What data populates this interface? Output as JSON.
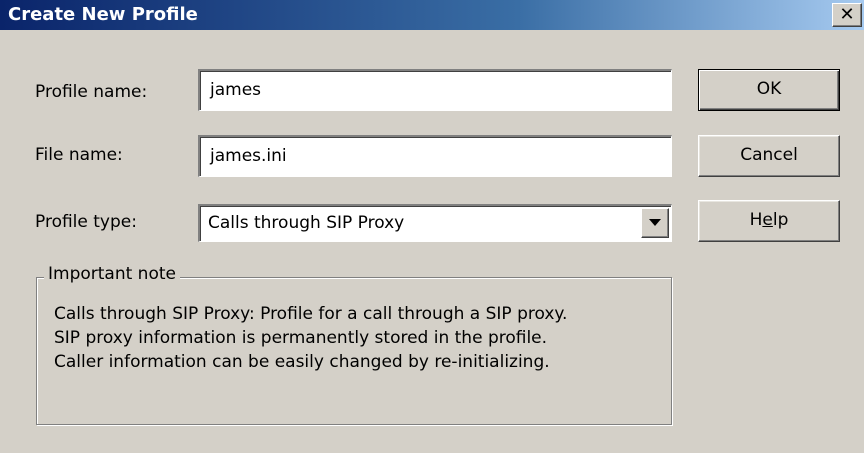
{
  "window": {
    "title": "Create New Profile",
    "close_glyph": "✕",
    "close_icon": "close-icon"
  },
  "form": {
    "profile_name_label": "Profile name:",
    "profile_name_value": "james",
    "file_name_label": "File name:",
    "file_name_value": "james.ini",
    "profile_type_label": "Profile type:",
    "profile_type_value": "Calls through SIP Proxy",
    "dropdown_icon": "chevron-down-icon"
  },
  "buttons": {
    "ok": "OK",
    "cancel": "Cancel",
    "help_pre": "H",
    "help_mnemonic": "e",
    "help_post": "lp"
  },
  "note": {
    "title": "Important note",
    "lines": [
      "Calls through SIP Proxy: Profile for a call through a SIP proxy.",
      "SIP proxy information is permanently stored in the profile.",
      "Caller information can be easily changed by re-initializing."
    ]
  },
  "colors": {
    "dialog_bg": "#d4d0c8",
    "titlebar_start": "#0a246a",
    "titlebar_end": "#a6caf0"
  }
}
